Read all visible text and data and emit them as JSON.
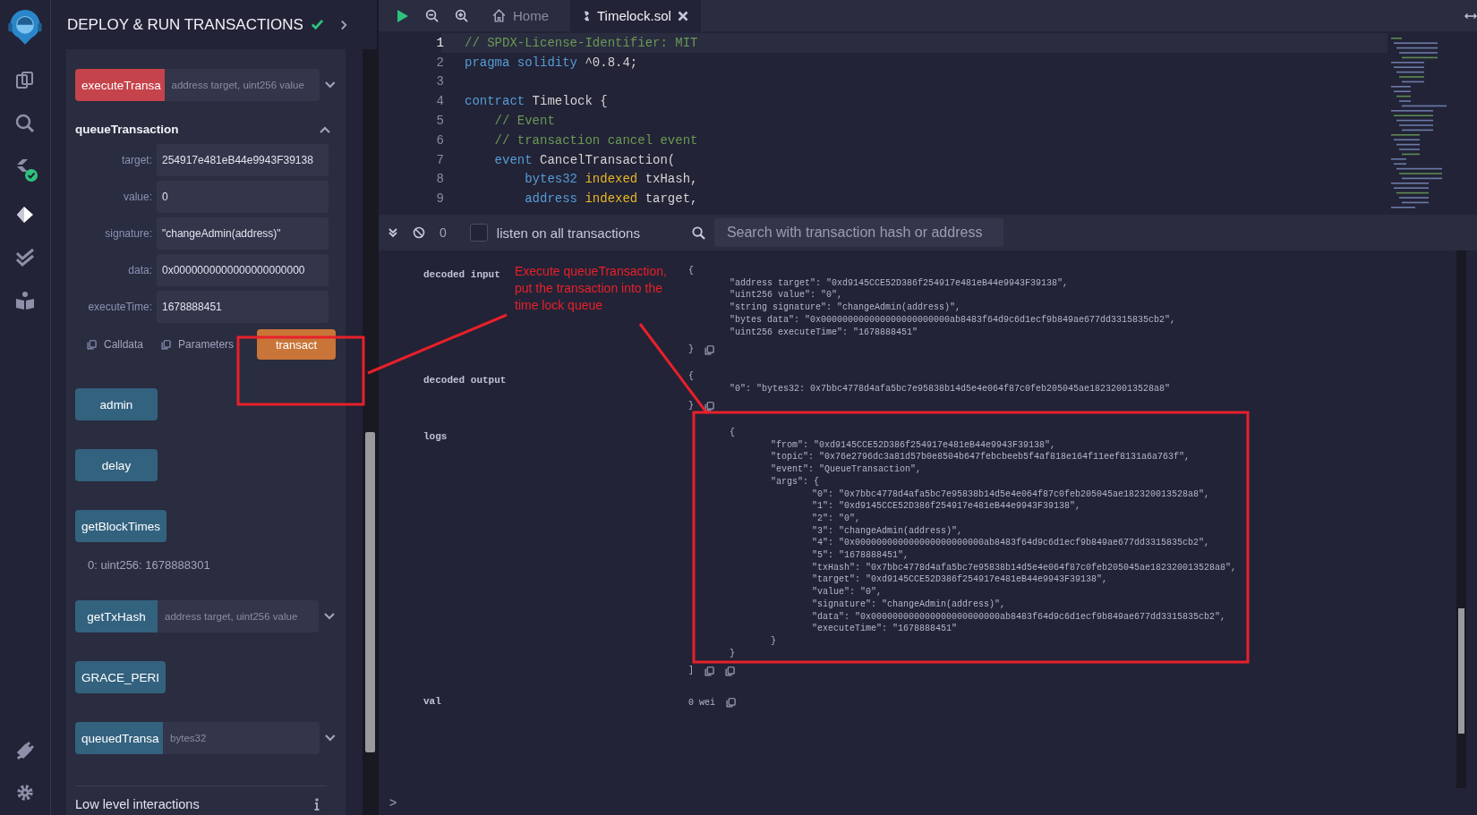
{
  "side_panel": {
    "title": "DEPLOY & RUN TRANSACTIONS",
    "compiled": true,
    "functions": [
      {
        "kind": "payable",
        "label": "executeTransa",
        "placeholder": "address target, uint256 value"
      },
      {
        "kind": "expanded",
        "label": "queueTransaction",
        "fields": [
          {
            "label": "target:",
            "value": "254917e481eB44e9943F39138"
          },
          {
            "label": "value:",
            "value": "0"
          },
          {
            "label": "signature:",
            "value": "\"changeAdmin(address)\""
          },
          {
            "label": "data:",
            "value": "0x0000000000000000000000"
          },
          {
            "label": "executeTime:",
            "value": "1678888451"
          }
        ],
        "actions": [
          "Calldata",
          "Parameters"
        ],
        "submit": "transact"
      },
      {
        "kind": "view",
        "label": "admin"
      },
      {
        "kind": "view",
        "label": "delay"
      },
      {
        "kind": "view",
        "label": "getBlockTimes",
        "result": "0: uint256: 1678888301"
      },
      {
        "kind": "view",
        "label": "getTxHash",
        "placeholder": "address target, uint256 value"
      },
      {
        "kind": "view",
        "label": "GRACE_PERI"
      },
      {
        "kind": "view",
        "label": "queuedTransa",
        "placeholder": "bytes32"
      }
    ],
    "low_level": "Low level interactions"
  },
  "tabs": [
    {
      "label": "Home",
      "kind": "home",
      "selected": false
    },
    {
      "label": "Timelock.sol",
      "kind": "file",
      "selected": true
    }
  ],
  "editor": {
    "lines": [
      {
        "number": "1",
        "current": true,
        "tokens": [
          {
            "kind": "comment",
            "text": "// SPDX-License-Identifier: MIT"
          }
        ]
      },
      {
        "number": "2",
        "current": false,
        "tokens": [
          {
            "kind": "keyword",
            "text": "pragma solidity"
          },
          {
            "kind": "plain",
            "text": " ^0.8.4;"
          }
        ]
      },
      {
        "number": "3",
        "current": false
      },
      {
        "number": "4",
        "current": false,
        "tokens": [
          {
            "kind": "keyword",
            "text": "contract"
          },
          {
            "kind": "plain",
            "text": " Timelock {"
          }
        ]
      },
      {
        "number": "5",
        "current": false,
        "tokens": [
          {
            "kind": "comment",
            "text": "    // Event"
          }
        ]
      },
      {
        "number": "6",
        "current": false,
        "tokens": [
          {
            "kind": "comment",
            "text": "    // transaction cancel event"
          }
        ]
      },
      {
        "number": "7",
        "current": false,
        "tokens": [
          {
            "kind": "keyword",
            "text": "    event"
          },
          {
            "kind": "plain",
            "text": " CancelTransaction("
          }
        ]
      },
      {
        "number": "8",
        "current": false,
        "tokens": [
          {
            "kind": "keyword",
            "text": "        bytes32 "
          },
          {
            "kind": "modifier",
            "text": "indexed"
          },
          {
            "kind": "plain",
            "text": " txHash,"
          }
        ]
      },
      {
        "number": "9",
        "current": false,
        "tokens": [
          {
            "kind": "keyword",
            "text": "        address "
          },
          {
            "kind": "modifier",
            "text": "indexed"
          },
          {
            "kind": "plain",
            "text": " target,"
          }
        ]
      }
    ]
  },
  "terminal": {
    "count": "0",
    "listen": {
      "label": "listen on all transactions",
      "checked": false
    },
    "search": {
      "placeholder": "Search with transaction hash or address"
    },
    "prompt": ">"
  },
  "console": {
    "rows": [
      {
        "kind": "json",
        "label": "decoded input",
        "value": {
          "open": "{",
          "children": [
            "\"address target\": \"0xd9145CCE52D386f254917e481eB44e9943F39138\",",
            "\"uint256 value\": \"0\",",
            "\"string signature\": \"changeAdmin(address)\",",
            "\"bytes data\": \"0x000000000000000000000000ab8483f64d9c6d1ecf9b849ae677dd3315835cb2\",",
            "\"uint256 executeTime\": \"1678888451\""
          ],
          "close": "}"
        }
      },
      {
        "kind": "json",
        "label": "decoded output",
        "value": {
          "open": "{",
          "children": [
            "\"0\": \"bytes32: 0x7bbc4778d4afa5bc7e95838b14d5e4e064f87c0feb205045ae182320013528a8\""
          ],
          "close": "}"
        }
      },
      {
        "kind": "json_log",
        "label": "logs",
        "value": {
          "children": [
            {
              "open": "{",
              "children": [
                "\"from\": \"0xd9145CCE52D386f254917e481eB44e9943F39138\",",
                "\"topic\": \"0x76e2796dc3a81d57b0e8504b647febcbeeb5f4af818e164f11eef8131a6a763f\",",
                "\"event\": \"QueueTransaction\",",
                {
                  "open": "\"args\": {",
                  "children": [
                    "\"0\": \"0x7bbc4778d4afa5bc7e95838b14d5e4e064f87c0feb205045ae182320013528a8\",",
                    "\"1\": \"0xd9145CCE52D386f254917e481eB44e9943F39138\",",
                    "\"2\": \"0\",",
                    "\"3\": \"changeAdmin(address)\",",
                    "\"4\": \"0x000000000000000000000000ab8483f64d9c6d1ecf9b849ae677dd3315835cb2\",",
                    "\"5\": \"1678888451\",",
                    "\"txHash\": \"0x7bbc4778d4afa5bc7e95838b14d5e4e064f87c0feb205045ae182320013528a8\",",
                    "\"target\": \"0xd9145CCE52D386f254917e481eB44e9943F39138\",",
                    "\"value\": \"0\",",
                    "\"signature\": \"changeAdmin(address)\",",
                    "\"data\": \"0x000000000000000000000000ab8483f64d9c6d1ecf9b849ae677dd3315835cb2\",",
                    "\"executeTime\": \"1678888451\""
                  ],
                  "close": "}"
                }
              ],
              "close": "}"
            }
          ],
          "close": "]"
        }
      },
      {
        "kind": "value",
        "label": "val",
        "value": "0 wei"
      }
    ]
  },
  "annotation": {
    "text": "Execute queueTransaction, put the transaction into the time lock queue"
  }
}
